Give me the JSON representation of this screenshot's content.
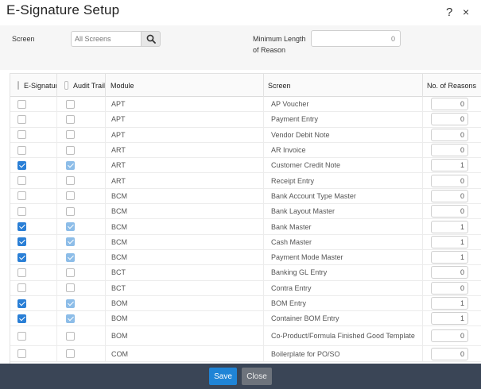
{
  "dialog": {
    "title": "E-Signature Setup",
    "help_glyph": "?",
    "close_glyph": "×"
  },
  "filters": {
    "screen_label": "Screen",
    "search_placeholder": "All Screens",
    "min_length_label": "Minimum Length of Reason",
    "min_length_value": "0"
  },
  "grid": {
    "columns": {
      "esig": "E-Signature",
      "audit": "Audit Trail",
      "module": "Module",
      "screen": "Screen",
      "num": "No. of Reasons"
    },
    "rows": [
      {
        "esig": false,
        "audit": false,
        "module": "APT",
        "screen": "AP Voucher",
        "num": "0"
      },
      {
        "esig": false,
        "audit": false,
        "module": "APT",
        "screen": "Payment Entry",
        "num": "0"
      },
      {
        "esig": false,
        "audit": false,
        "module": "APT",
        "screen": "Vendor Debit Note",
        "num": "0"
      },
      {
        "esig": false,
        "audit": false,
        "module": "ART",
        "screen": "AR Invoice",
        "num": "0"
      },
      {
        "esig": true,
        "audit": true,
        "module": "ART",
        "screen": "Customer Credit Note",
        "num": "1"
      },
      {
        "esig": false,
        "audit": false,
        "module": "ART",
        "screen": "Receipt Entry",
        "num": "0"
      },
      {
        "esig": false,
        "audit": false,
        "module": "BCM",
        "screen": "Bank Account Type Master",
        "num": "0"
      },
      {
        "esig": false,
        "audit": false,
        "module": "BCM",
        "screen": "Bank Layout Master",
        "num": "0"
      },
      {
        "esig": true,
        "audit": true,
        "module": "BCM",
        "screen": "Bank Master",
        "num": "1"
      },
      {
        "esig": true,
        "audit": true,
        "module": "BCM",
        "screen": "Cash Master",
        "num": "1"
      },
      {
        "esig": true,
        "audit": true,
        "module": "BCM",
        "screen": "Payment Mode Master",
        "num": "1"
      },
      {
        "esig": false,
        "audit": false,
        "module": "BCT",
        "screen": "Banking GL Entry",
        "num": "0"
      },
      {
        "esig": false,
        "audit": false,
        "module": "BCT",
        "screen": "Contra Entry",
        "num": "0"
      },
      {
        "esig": true,
        "audit": true,
        "module": "BOM",
        "screen": "BOM Entry",
        "num": "1"
      },
      {
        "esig": true,
        "audit": true,
        "module": "BOM",
        "screen": "Container BOM Entry",
        "num": "1"
      },
      {
        "esig": false,
        "audit": false,
        "module": "BOM",
        "screen": "Co-Product/Formula Finished Good Template",
        "num": "0",
        "tall": true
      },
      {
        "esig": false,
        "audit": false,
        "module": "COM",
        "screen": "Boilerplate for PO/SO",
        "num": "0"
      }
    ]
  },
  "footer": {
    "save_label": "Save",
    "close_label": "Close"
  }
}
